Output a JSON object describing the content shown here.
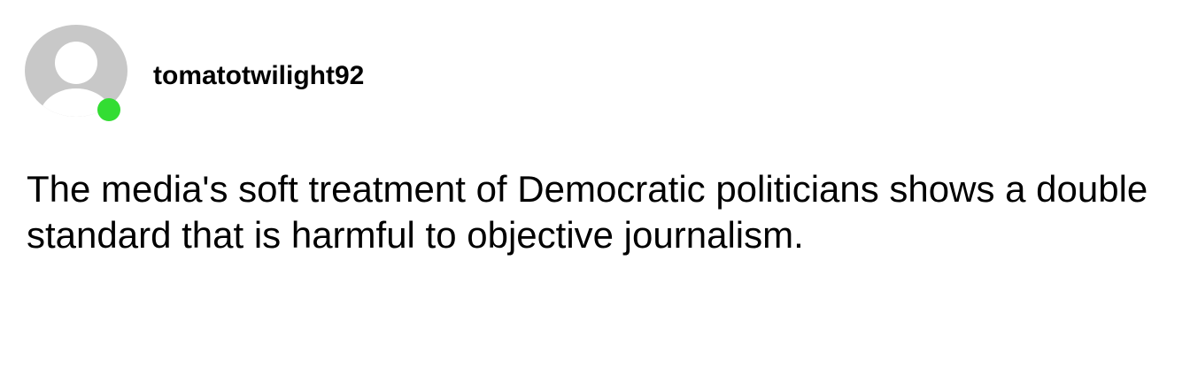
{
  "post": {
    "author": {
      "username": "tomatotwilight92",
      "avatar_icon": "default-user-avatar-icon",
      "online": true,
      "status_color": "#33dd33"
    },
    "text": "The media's soft treatment of Democratic politicians shows a double standard that is harmful to objective journalism."
  },
  "colors": {
    "avatar_background": "#c8c8c8",
    "avatar_figure": "#ffffff",
    "text": "#000000",
    "page_background": "#ffffff"
  }
}
